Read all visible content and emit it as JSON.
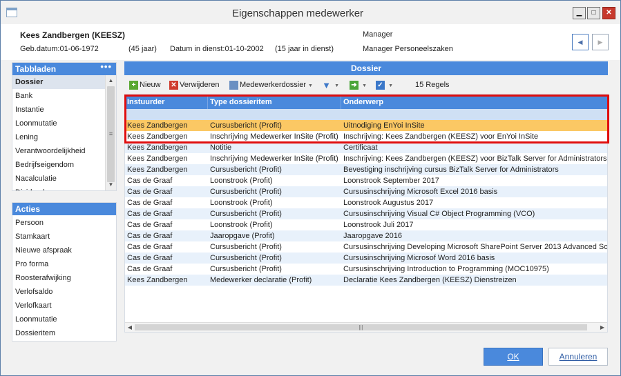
{
  "window": {
    "title": "Eigenschappen medewerker",
    "icon": "app-window-icon"
  },
  "header": {
    "name": "Kees Zandbergen (KEESZ)",
    "birth": "Geb.datum:01-06-1972",
    "age": "(45 jaar)",
    "in_service": "Datum in dienst:01-10-2002",
    "service_years": "(15 jaar in dienst)",
    "role": "Manager",
    "position": "Manager Personeelszaken"
  },
  "tabbladen": {
    "title": "Tabbladen",
    "more": "•••",
    "items": [
      "Dossier",
      "Bank",
      "Instantie",
      "Loonmutatie",
      "Lening",
      "Verantwoordelijkheid",
      "Bedrijfseigendom",
      "Nacalculatie",
      "Dividend"
    ]
  },
  "acties": {
    "title": "Acties",
    "items": [
      "Persoon",
      "Stamkaart",
      "Nieuwe afspraak",
      "Pro forma",
      "Roosterafwijking",
      "Verlofsaldo",
      "Verlofkaart",
      "Loonmutatie",
      "Dossieritem"
    ]
  },
  "dossier": {
    "title": "Dossier",
    "toolbar": {
      "new": "Nieuw",
      "delete": "Verwijderen",
      "employee_file": "Medewerkerdossier",
      "row_count": "15 Regels"
    },
    "columns": [
      "Instuurder",
      "Type dossieritem",
      "Onderwerp"
    ],
    "rows": [
      [
        "Kees Zandbergen",
        "Cursusbericht (Profit)",
        "Uitnodiging EnYoi InSite"
      ],
      [
        "Kees Zandbergen",
        "Inschrijving Medewerker InSite (Profit)",
        "Inschrijving: Kees Zandbergen (KEESZ) voor EnYoi InSite"
      ],
      [
        "Kees Zandbergen",
        "Notitie",
        "Certificaat"
      ],
      [
        "Kees Zandbergen",
        "Inschrijving Medewerker InSite (Profit)",
        "Inschrijving: Kees Zandbergen (KEESZ) voor BizTalk Server for Administrators"
      ],
      [
        "Kees Zandbergen",
        "Cursusbericht (Profit)",
        "Bevestiging inschrijving cursus BizTalk Server for Administrators"
      ],
      [
        "Cas de Graaf",
        "Loonstrook (Profit)",
        "Loonstrook September 2017"
      ],
      [
        "Cas de Graaf",
        "Cursusbericht (Profit)",
        "Cursusinschrijving Microsoft Excel 2016 basis"
      ],
      [
        "Cas de Graaf",
        "Loonstrook (Profit)",
        "Loonstrook Augustus 2017"
      ],
      [
        "Cas de Graaf",
        "Cursusbericht (Profit)",
        "Cursusinschrijving Visual C# Object Programming (VCO)"
      ],
      [
        "Cas de Graaf",
        "Loonstrook (Profit)",
        "Loonstrook Juli 2017"
      ],
      [
        "Cas de Graaf",
        "Jaaropgave (Profit)",
        "Jaaropgave 2016"
      ],
      [
        "Cas de Graaf",
        "Cursusbericht (Profit)",
        "Cursusinschrijving Developing Microsoft SharePoint Server 2013 Advanced Solut"
      ],
      [
        "Cas de Graaf",
        "Cursusbericht (Profit)",
        "Cursusinschrijving Microsof Word 2016 basis"
      ],
      [
        "Cas de Graaf",
        "Cursusbericht (Profit)",
        "Cursusinschrijving Introduction to Programming (MOC10975)"
      ],
      [
        "Kees Zandbergen",
        "Medewerker declaratie (Profit)",
        "Declaratie Kees Zandbergen (KEESZ) Dienstreizen"
      ]
    ]
  },
  "buttons": {
    "ok": "OK",
    "cancel": "Annuleren"
  },
  "colors": {
    "accent": "#4a89dc",
    "highlight_row": "#fbc864",
    "annotation_box": "#e00d0d"
  }
}
